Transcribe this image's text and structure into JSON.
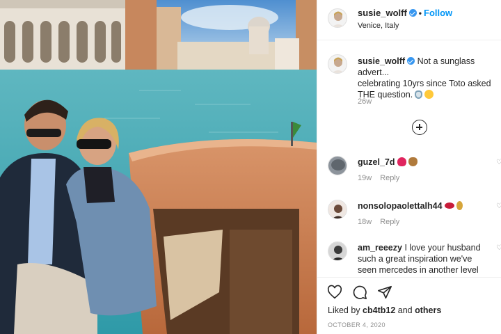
{
  "post": {
    "username": "susie_wolff",
    "separator": "•",
    "follow_label": "Follow",
    "location": "Venice, Italy"
  },
  "caption": {
    "username": "susie_wolff",
    "line1": "Not a sunglass advert...",
    "line2": "celebrating 10yrs since Toto asked",
    "line3": "THE question.",
    "emojis": [
      "ring-emoji",
      "smiling-face-hearts-emoji"
    ],
    "time": "26w"
  },
  "comments": [
    {
      "username": "guzel_7d",
      "text": "",
      "time": "19w",
      "reply": "Reply",
      "emojis": [
        "heart-emoji",
        "bag-emoji"
      ]
    },
    {
      "username": "nonsolopaolettalh44",
      "text": "",
      "time": "18w",
      "reply": "Reply",
      "emojis": [
        "lips-emoji",
        "drop-emoji"
      ]
    },
    {
      "username": "am_reeezy",
      "text": "I love your husband",
      "line2": "such a great inspiration we've",
      "line3": "seen mercedes in another level"
    }
  ],
  "actions": {
    "liked_prefix": "Liked by",
    "liked_user": "cb4tb12",
    "liked_and": "and",
    "liked_others": "others",
    "date": "OCTOBER 4, 2020"
  },
  "colors": {
    "link_blue": "#0095f6",
    "verified_blue": "#3897f0",
    "muted": "#8e8e8e",
    "text": "#262626"
  }
}
